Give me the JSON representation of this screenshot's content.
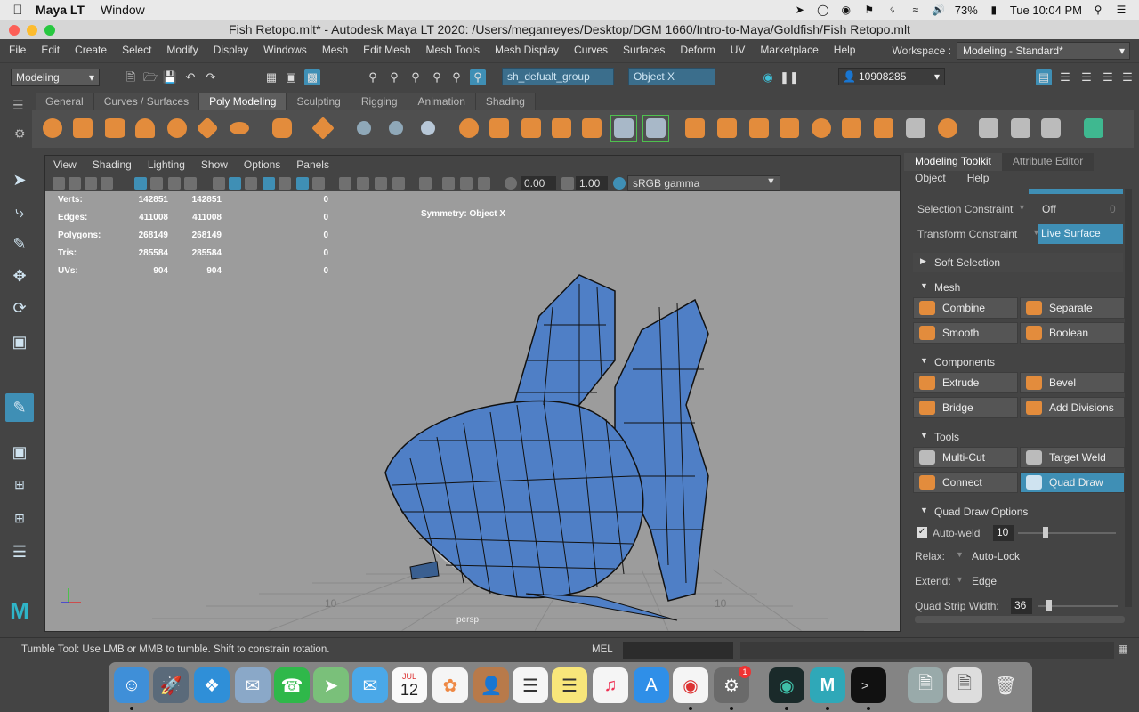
{
  "menubar": {
    "app_name": "Maya LT",
    "menu": "Window",
    "battery": "73%",
    "clock": "Tue 10:04 PM"
  },
  "window": {
    "title": "Fish Retopo.mlt* - Autodesk Maya LT 2020: /Users/meganreyes/Desktop/DGM 1660/Intro-to-Maya/Goldfish/Fish Retopo.mlt"
  },
  "maya_menu": {
    "items": [
      "File",
      "Edit",
      "Create",
      "Select",
      "Modify",
      "Display",
      "Windows",
      "Mesh",
      "Edit Mesh",
      "Mesh Tools",
      "Mesh Display",
      "Curves",
      "Surfaces",
      "Deform",
      "UV",
      "Marketplace",
      "Help"
    ],
    "workspace_label": "Workspace :",
    "workspace_value": "Modeling - Standard*"
  },
  "statusline": {
    "mode": "Modeling",
    "selection_field": "sh_defualt_group",
    "symmetry_field": "Object X",
    "user_id": "10908285"
  },
  "shelf": {
    "tabs": [
      "General",
      "Curves / Surfaces",
      "Poly Modeling",
      "Sculpting",
      "Rigging",
      "Animation",
      "Shading"
    ],
    "active_tab": "Poly Modeling"
  },
  "viewport": {
    "menu": [
      "View",
      "Shading",
      "Lighting",
      "Show",
      "Options",
      "Panels"
    ],
    "exposure": "0.00",
    "gamma": "1.00",
    "color_space": "sRGB gamma",
    "hud": {
      "rows": [
        {
          "label": "Verts:",
          "a": "142851",
          "b": "142851",
          "c": "0"
        },
        {
          "label": "Edges:",
          "a": "411008",
          "b": "411008",
          "c": "0"
        },
        {
          "label": "Polygons:",
          "a": "268149",
          "b": "268149",
          "c": "0"
        },
        {
          "label": "Tris:",
          "a": "285584",
          "b": "285584",
          "c": "0"
        },
        {
          "label": "UVs:",
          "a": "904",
          "b": "904",
          "c": "0"
        }
      ]
    },
    "symmetry_label": "Symmetry: Object X",
    "camera": "persp",
    "grid_label_left": "10",
    "grid_label_right": "10"
  },
  "right_panel": {
    "tabs": [
      "Modeling Toolkit",
      "Attribute Editor"
    ],
    "menu": [
      "Object",
      "Help"
    ],
    "selection_constraint_label": "Selection Constraint",
    "selection_constraint_value": "Off",
    "selection_constraint_num": "0",
    "transform_constraint_label": "Transform Constraint",
    "transform_constraint_value": "Live Surface",
    "sections": {
      "soft_selection": "Soft Selection",
      "mesh": "Mesh",
      "components": "Components",
      "tools": "Tools",
      "quad_draw_options": "Quad Draw Options"
    },
    "mesh_buttons": [
      "Combine",
      "Separate",
      "Smooth",
      "Boolean"
    ],
    "component_buttons": [
      "Extrude",
      "Bevel",
      "Bridge",
      "Add Divisions"
    ],
    "tool_buttons": [
      "Multi-Cut",
      "Target Weld",
      "Connect",
      "Quad Draw"
    ],
    "auto_weld_label": "Auto-weld",
    "auto_weld_value": "10",
    "relax_label": "Relax:",
    "relax_value": "Auto-Lock",
    "extend_label": "Extend:",
    "extend_value": "Edge",
    "quad_strip_label": "Quad Strip Width:",
    "quad_strip_value": "36"
  },
  "helpline": {
    "text": "Tumble Tool: Use LMB or MMB to tumble. Shift to constrain rotation.",
    "mel": "MEL"
  },
  "dock": {
    "calendar_month": "JUL",
    "calendar_day": "12",
    "badge": "1"
  },
  "colors": {
    "accent": "#3f8fb5",
    "shelf_icon": "#e38c3c",
    "mesh_blue": "#4f7fc6"
  }
}
